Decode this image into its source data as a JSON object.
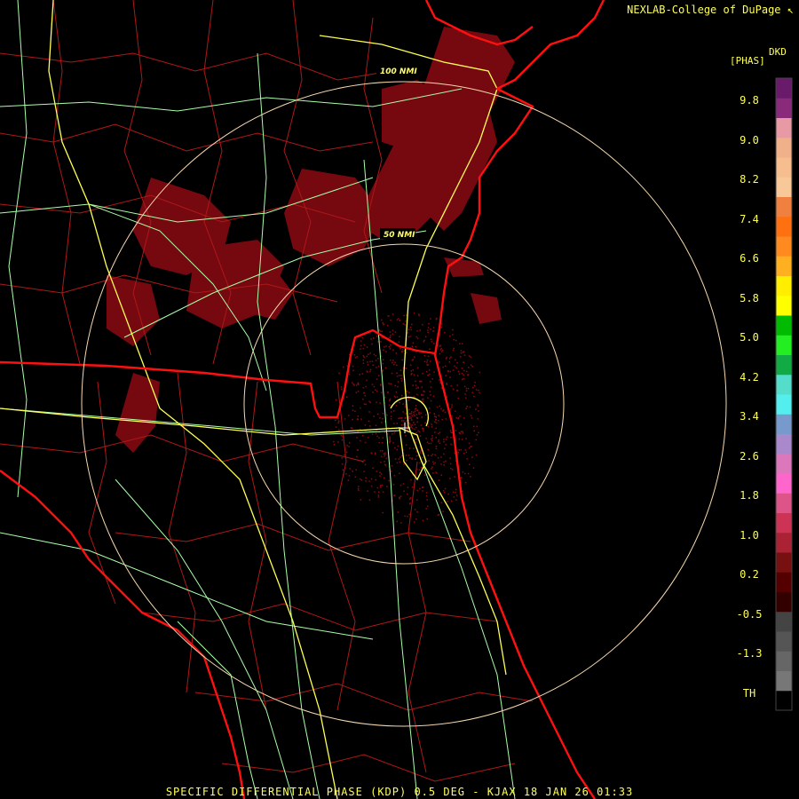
{
  "credit": "NEXLAB-College of DuPage",
  "credit_icon": "cursor-arrow-icon",
  "caption": "SPECIFIC DIFFERENTIAL PHASE (KDP) 0.5 DEG - KJAX 18 JAN 26 01:33",
  "product_code": "DKD",
  "product_unit": "[PHAS]",
  "ring_labels": [
    "50 NMI",
    "100 NMI"
  ],
  "legend": {
    "labels": [
      "9.8",
      "9.0",
      "8.2",
      "7.4",
      "6.6",
      "5.8",
      "5.0",
      "4.2",
      "3.4",
      "2.6",
      "1.8",
      "1.0",
      "0.2",
      "-0.5",
      "-1.3",
      "TH"
    ],
    "colors_top_to_bottom": [
      "#6a1a6a",
      "#8a2a7a",
      "#e89aa4",
      "#f0b08a",
      "#f6be8e",
      "#f8c898",
      "#f08040",
      "#ff7010",
      "#ff8a20",
      "#ffb020",
      "#ffee00",
      "#ffff00",
      "#00bb00",
      "#22ee22",
      "#11aa44",
      "#55ddcc",
      "#55eeee",
      "#7799cc",
      "#aa88cc",
      "#dd77bb",
      "#ff66cc",
      "#dd5588",
      "#cc3355",
      "#aa2233",
      "#771111",
      "#550000",
      "#330000",
      "#444444",
      "#555555",
      "#666666",
      "#777777",
      "#000000"
    ]
  },
  "colors": {
    "state_border": "#ff1010",
    "county_border": "#b01818",
    "interstate": "#ffff55",
    "highway": "#aaffaa",
    "range_ring": "#f8d8b0",
    "echo": "#8b0a12"
  }
}
